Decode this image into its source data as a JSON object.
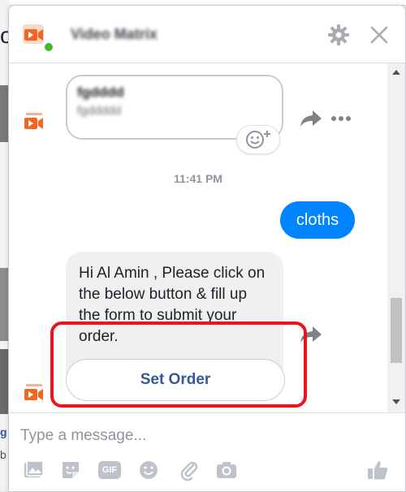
{
  "chat": {
    "title": "Video Matrix",
    "blurred_message": {
      "line1": "fgdddd",
      "line2": "fgddddd"
    },
    "timestamp": "11:41 PM",
    "sent_message": "cloths",
    "received_message": "Hi  Al Amin , Please click on the below button & fill up the form to submit your order.",
    "action_button": "Set Order",
    "composer_placeholder": "Type a message...",
    "gif_label": "GIF"
  },
  "background_page": {
    "fragment_top": "o(",
    "fragment_mid": "g",
    "fragment_bottom": "b"
  },
  "colors": {
    "accent": "#0084ff",
    "link": "#365899",
    "highlight": "#e8151e",
    "brand_orange": "#f26522"
  },
  "icons": [
    "video-matrix-logo-icon",
    "settings-icon",
    "close-icon",
    "share-icon",
    "more-icon",
    "emoji-reaction-icon",
    "photo-icon",
    "sticker-icon",
    "gif-icon",
    "emoji-icon",
    "attachment-icon",
    "camera-icon",
    "thumbs-up-icon"
  ]
}
